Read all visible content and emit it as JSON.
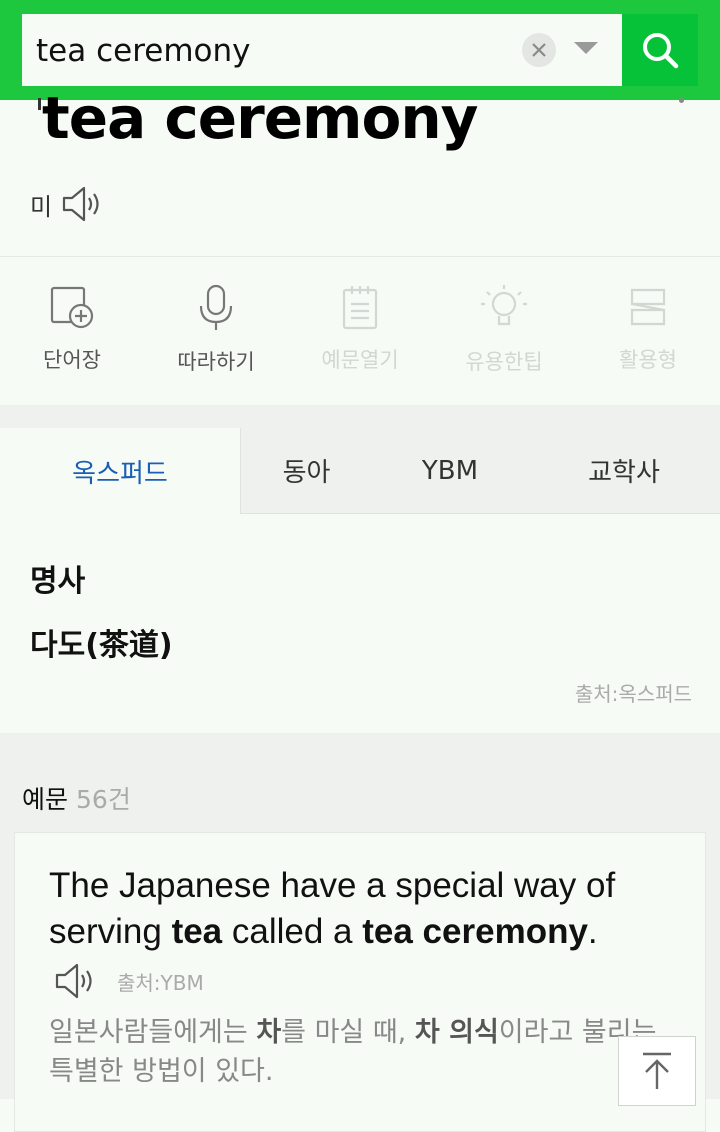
{
  "search": {
    "query": "tea ceremony"
  },
  "entry": {
    "headword": "tea ceremony",
    "pron_label": "미"
  },
  "tools": [
    {
      "label": "단어장",
      "icon": "add-to-wordbook-icon",
      "enabled": true
    },
    {
      "label": "따라하기",
      "icon": "microphone-icon",
      "enabled": true
    },
    {
      "label": "예문열기",
      "icon": "notepad-icon",
      "enabled": false
    },
    {
      "label": "유용한팁",
      "icon": "lightbulb-icon",
      "enabled": false
    },
    {
      "label": "활용형",
      "icon": "conjugation-icon",
      "enabled": false
    }
  ],
  "tabs": [
    {
      "label": "옥스퍼드",
      "active": true
    },
    {
      "label": "동아",
      "active": false
    },
    {
      "label": "YBM",
      "active": false
    },
    {
      "label": "교학사",
      "active": false
    }
  ],
  "definition": {
    "pos": "명사",
    "meaning": "다도(茶道)",
    "source": "출처:옥스퍼드"
  },
  "examples": {
    "title": "예문",
    "count": "56건",
    "items": [
      {
        "en_parts": [
          "The Japanese have a special way of serving ",
          "tea",
          " called a ",
          "tea ceremony",
          "."
        ],
        "source": "출처:YBM",
        "ko_parts": [
          "일본사람들에게는 ",
          "차",
          "를 마실 때, ",
          "차 의식",
          "이라고 불리는 특별한 방법이 있다."
        ]
      }
    ]
  },
  "colors": {
    "brand_green": "#1ec83e",
    "search_button": "#06c238",
    "active_tab": "#1a5fb4"
  }
}
